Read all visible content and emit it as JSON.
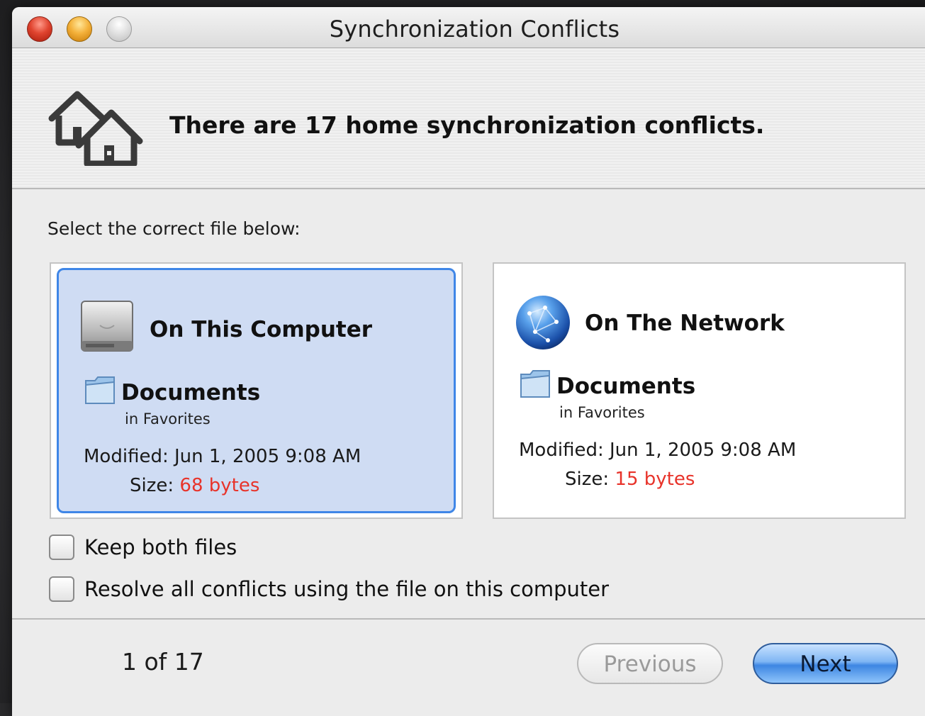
{
  "window": {
    "title": "Synchronization Conflicts"
  },
  "header": {
    "message": "There are 17 home synchronization conflicts.",
    "icon": "home-sync-icon"
  },
  "instruction": "Select the correct file below:",
  "panels": [
    {
      "source": "On This Computer",
      "source_icon": "hard-drive-icon",
      "selected": true,
      "file_name": "Documents",
      "location": "in Favorites",
      "modified_label": "Modified:",
      "modified_value": "Jun 1, 2005 9:08 AM",
      "size_label": "Size:",
      "size_value": "68 bytes"
    },
    {
      "source": "On The Network",
      "source_icon": "network-globe-icon",
      "selected": false,
      "file_name": "Documents",
      "location": "in Favorites",
      "modified_label": "Modified:",
      "modified_value": "Jun 1, 2005 9:08 AM",
      "size_label": "Size:",
      "size_value": "15 bytes"
    }
  ],
  "options": {
    "keep_both": "Keep both files",
    "resolve_all": "Resolve all conflicts using the file on this computer"
  },
  "footer": {
    "counter": "1 of 17",
    "previous_label": "Previous",
    "next_label": "Next"
  },
  "colors": {
    "selection_fill": "#cfdcf3",
    "selection_border": "#3f86e7",
    "size_value": "#e8332a",
    "default_button": "#3d86e2"
  }
}
